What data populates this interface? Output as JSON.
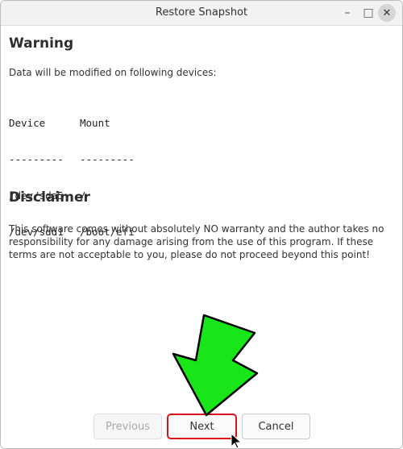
{
  "window": {
    "title": "Restore Snapshot",
    "controls": {
      "minimize": "–",
      "maximize": "□",
      "close": "✕"
    }
  },
  "warning": {
    "heading": "Warning",
    "text": "Data will be modified on following devices:",
    "table": {
      "headers": [
        "Device",
        "Mount"
      ],
      "separators": [
        "---------",
        "---------"
      ],
      "rows": [
        [
          "/dev/sda5",
          "/"
        ],
        [
          "/dev/sdd1",
          "/boot/efi"
        ]
      ]
    }
  },
  "disclaimer": {
    "heading": "Disclaimer",
    "text": "This software comes without absolutely NO warranty and the author takes no responsibility for any damage arising from the use of this program. If these terms are not acceptable to you, please do not proceed beyond this point!"
  },
  "buttons": {
    "previous": "Previous",
    "next": "Next",
    "cancel": "Cancel"
  },
  "colors": {
    "highlight": "#e0101a",
    "arrow": "#19e619"
  }
}
